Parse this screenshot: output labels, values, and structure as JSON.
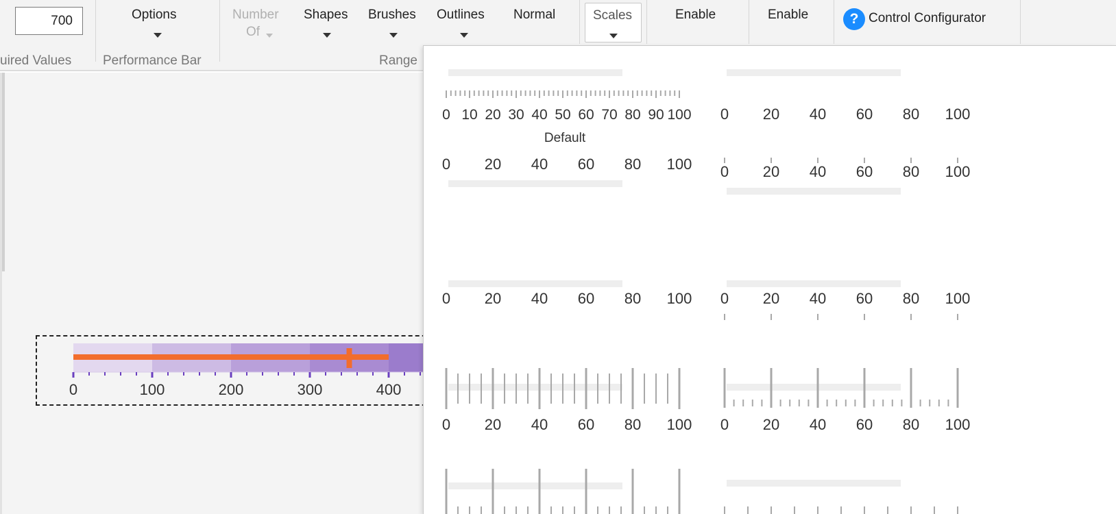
{
  "ribbon": {
    "value_input": "700",
    "options_label": "Options",
    "number_of_label_line1": "Number",
    "number_of_label_line2": "Of",
    "shapes_label": "Shapes",
    "brushes_label": "Brushes",
    "outlines_label": "Outlines",
    "normal_label": "Normal",
    "scales_label": "Scales",
    "enable_label_1": "Enable",
    "enable_label_2": "Enable",
    "control_configurator_label": "Control Configurator",
    "group_required_values": "uired Values",
    "group_performance_bar": "Performance Bar",
    "group_range": "Range"
  },
  "gallery": {
    "default_caption": "Default",
    "tiles": [
      {
        "id": "default",
        "labels": [
          "0",
          "10",
          "20",
          "30",
          "40",
          "50",
          "60",
          "70",
          "80",
          "90",
          "100"
        ]
      },
      {
        "id": "plain-top",
        "labels": [
          "0",
          "20",
          "40",
          "60",
          "80",
          "100"
        ]
      },
      {
        "id": "labels-above-bar",
        "labels": [
          "0",
          "20",
          "40",
          "60",
          "80",
          "100"
        ]
      },
      {
        "id": "small-ticks-above-bar",
        "labels": [
          "0",
          "20",
          "40",
          "60",
          "80",
          "100"
        ]
      },
      {
        "id": "labels-below-bar",
        "labels": [
          "0",
          "20",
          "40",
          "60",
          "80",
          "100"
        ]
      },
      {
        "id": "labels-ticks-below-bar",
        "labels": [
          "0",
          "20",
          "40",
          "60",
          "80",
          "100"
        ]
      },
      {
        "id": "long-ticks-through-bar",
        "labels": [
          "0",
          "20",
          "40",
          "60",
          "80",
          "100"
        ]
      },
      {
        "id": "major-minor-ticks-through-bar",
        "labels": [
          "0",
          "20",
          "40",
          "60",
          "80",
          "100"
        ]
      },
      {
        "id": "long-ticks-partial",
        "labels": []
      },
      {
        "id": "small-ticks-partial",
        "labels": []
      }
    ]
  },
  "bullet_graph": {
    "scale_labels": [
      "0",
      "100",
      "200",
      "300",
      "400"
    ],
    "range_colors": [
      "#e3d8ef",
      "#cdbbe4",
      "#b9a0da",
      "#a98bd2",
      "#9b7ccc"
    ],
    "performance_bar_color": "#f26d2d",
    "axis_color": "#6a3fbf",
    "performance_value": 400,
    "target_value": 350
  }
}
